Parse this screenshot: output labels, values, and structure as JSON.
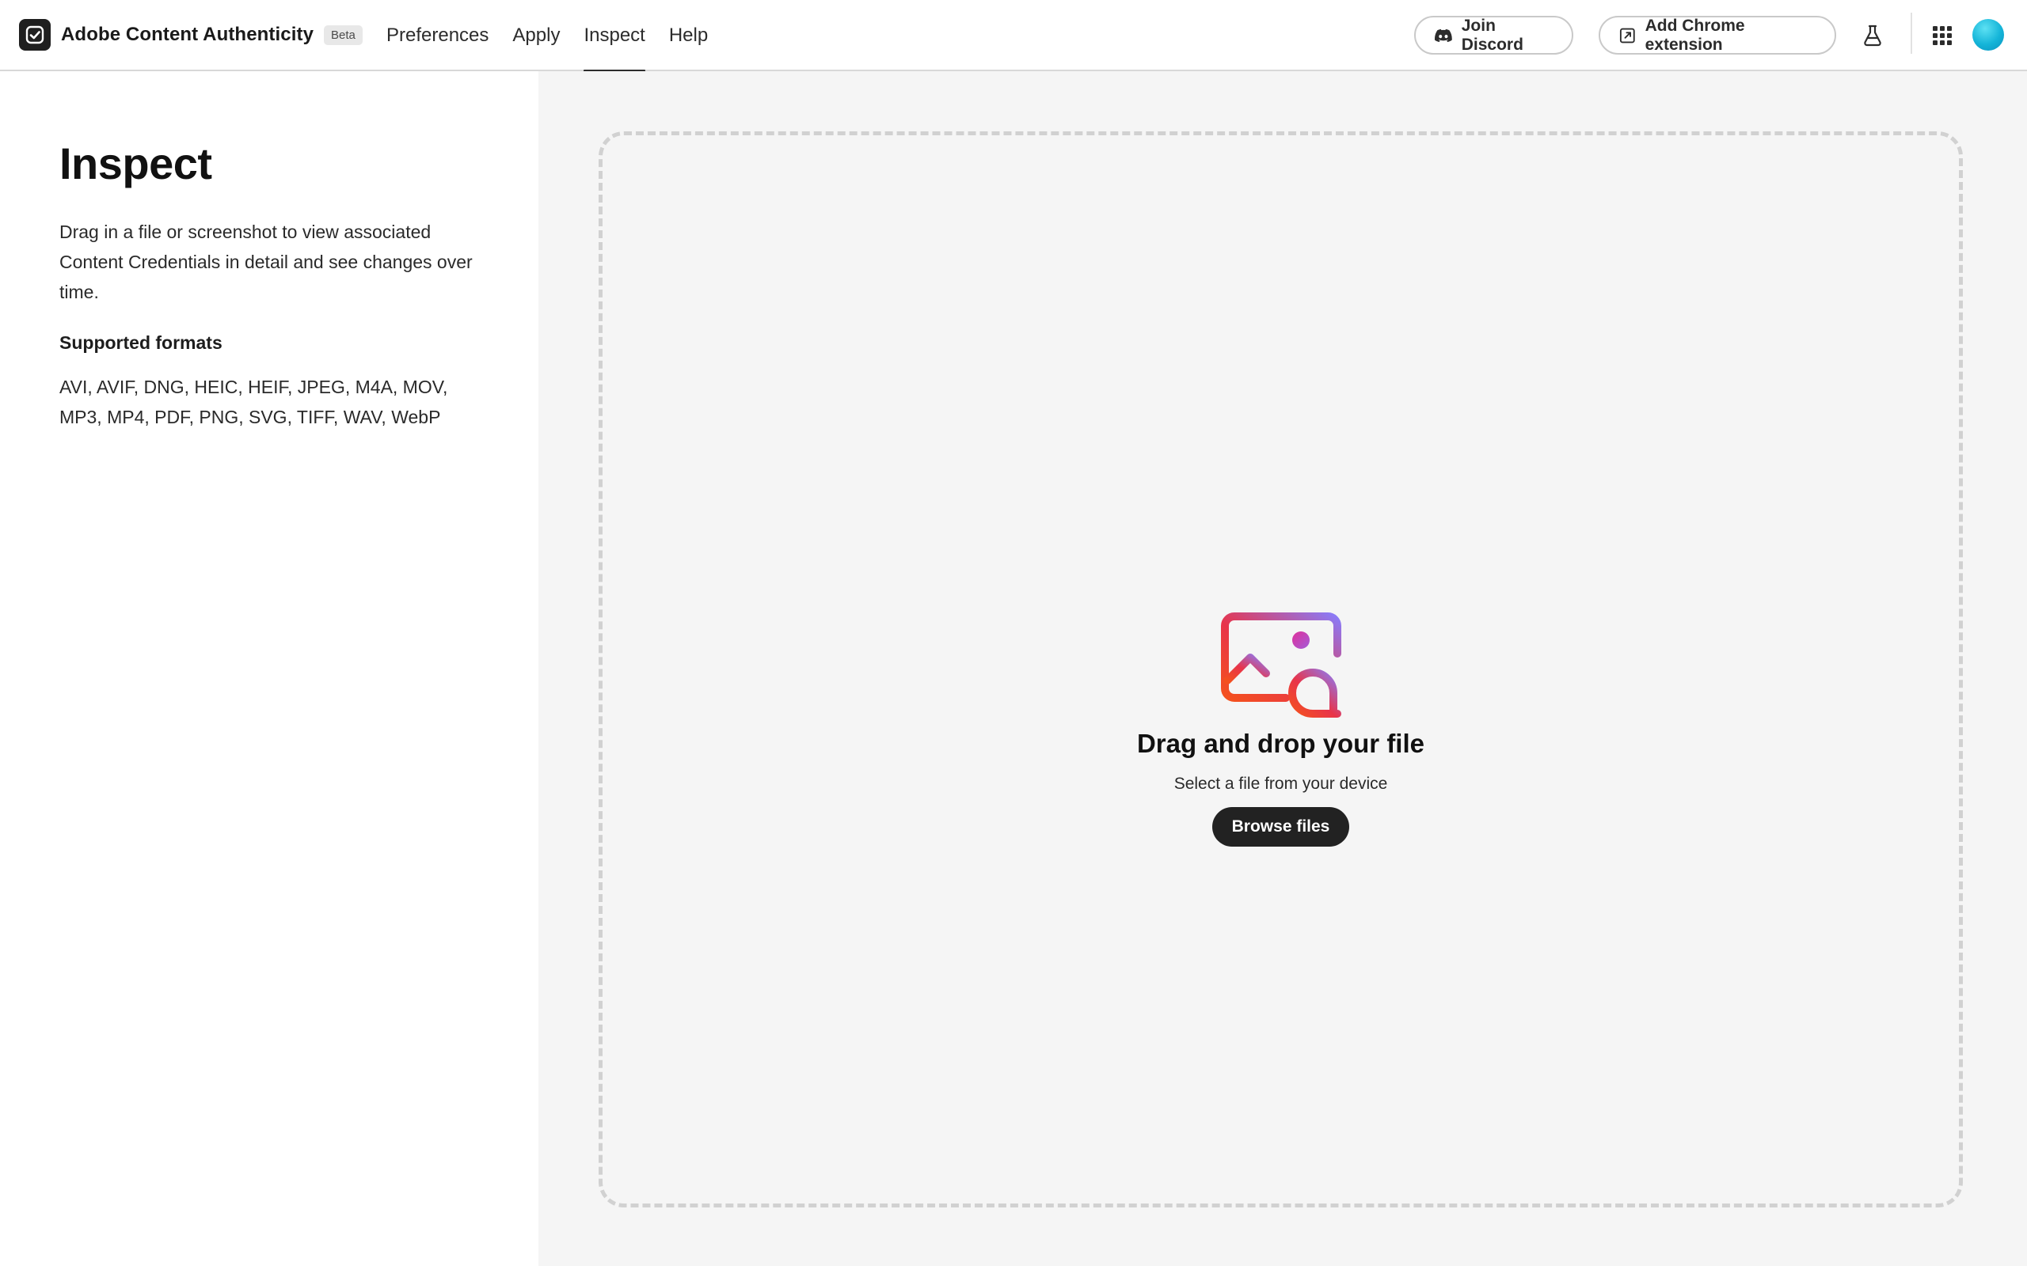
{
  "header": {
    "app_name": "Adobe Content Authenticity",
    "badge": "Beta",
    "nav": [
      {
        "label": "Preferences",
        "active": false
      },
      {
        "label": "Apply",
        "active": false
      },
      {
        "label": "Inspect",
        "active": true
      },
      {
        "label": "Help",
        "active": false
      }
    ],
    "discord_button": "Join Discord",
    "chrome_button": "Add Chrome extension",
    "icons": {
      "logo": "checkmark-badge-icon",
      "discord": "discord-icon",
      "chrome": "external-arrow-icon",
      "labs": "flask-icon",
      "apps": "app-grid-icon",
      "avatar": "avatar"
    }
  },
  "sidebar": {
    "title": "Inspect",
    "description": "Drag in a file or screenshot to view associated Content Credentials in detail and see changes over time.",
    "formats_heading": "Supported formats",
    "formats": "AVI, AVIF, DNG, HEIC, HEIF, JPEG, M4A, MOV, MP3, MP4, PDF, PNG, SVG, TIFF, WAV, WebP"
  },
  "dropzone": {
    "icon": "image-upload-icon",
    "title": "Drag and drop your file",
    "subtitle": "Select a file from your device",
    "button": "Browse files"
  },
  "colors": {
    "accent_dark": "#222222",
    "icon_gradient_start": "#f4511e",
    "icon_gradient_end": "#8b7bf7",
    "avatar": "#14b4d8",
    "dropzone_bg": "#f5f5f5"
  }
}
